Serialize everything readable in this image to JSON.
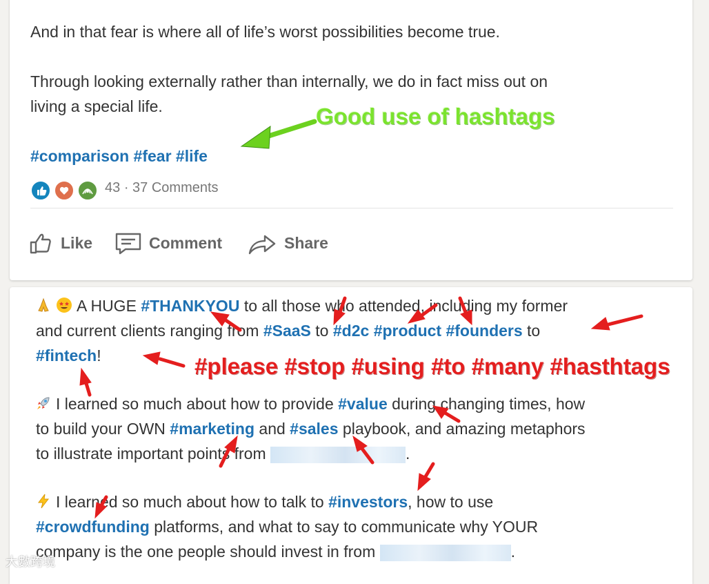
{
  "post1": {
    "paragraph1": "And in that fear is where all of life’s worst possibilities become true.",
    "paragraph2_line1": "Through looking externally rather than internally, we do in fact miss out on",
    "paragraph2_line2": "living a special life.",
    "hashtags": [
      "#comparison",
      "#fear",
      "#life"
    ],
    "reaction_count": "43",
    "separator": "·",
    "comments": "37 Comments",
    "actions": {
      "like": "Like",
      "comment": "Comment",
      "share": "Share"
    }
  },
  "annotations": {
    "good": "Good use of hashtags",
    "bad": "#please #stop #using #to #many #hasthtags"
  },
  "post2": {
    "l1": {
      "t1": "A HUGE ",
      "tag1": "#THANKYOU",
      "t2": " to all those who attended, including my former"
    },
    "l2": {
      "t1": "and current clients ranging from ",
      "tag1": "#SaaS",
      "t2": " to ",
      "tag2": "#d2c",
      "t3": " ",
      "tag3": "#product",
      "t4": " ",
      "tag4": "#founders",
      "t5": " to"
    },
    "l3": {
      "tag1": "#fintech",
      "t1": "!"
    },
    "l4": {
      "t1": "I learned so much about how to provide ",
      "tag1": "#value",
      "t2": " during changing times, how"
    },
    "l5": {
      "t1": "to build your OWN ",
      "tag1": "#marketing",
      "t2": " and ",
      "tag2": "#sales",
      "t3": " playbook, and amazing metaphors"
    },
    "l6": {
      "t1": "to illustrate important points from ",
      "t2": "."
    },
    "l7": {
      "t1": "I learned so much about how to talk to ",
      "tag1": "#investors",
      "t2": ", how to use"
    },
    "l8": {
      "tag1": "#crowdfunding",
      "t1": " platforms, and what to say to communicate why YOUR"
    },
    "l9": {
      "t1": "company is the one people should invest in from ",
      "t2": "."
    }
  },
  "emojis": [
    "folded-hands-icon",
    "star-struck-icon",
    "rocket-icon",
    "lightning-icon"
  ],
  "colors": {
    "hashtag": "#1f71b2",
    "annotation_green": "#7be32e",
    "annotation_red": "#e41e1e",
    "like_blue": "#1485bd",
    "love_red": "#df704d"
  },
  "watermark": "大數跨境"
}
